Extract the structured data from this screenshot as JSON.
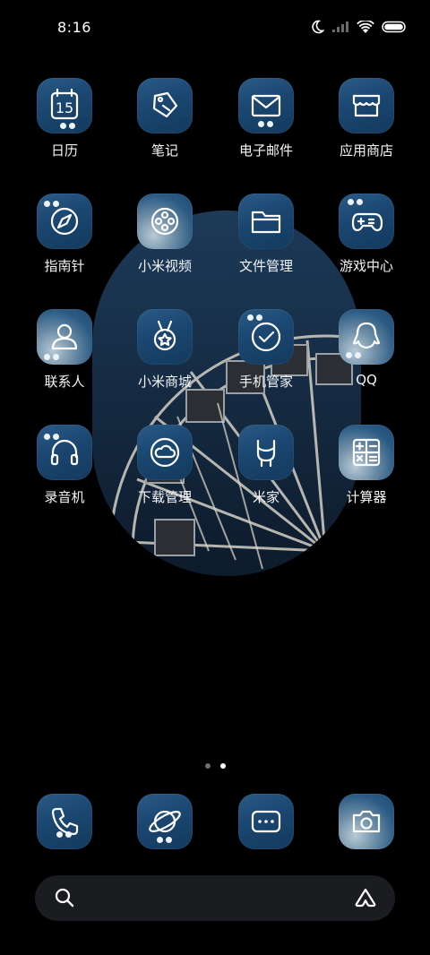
{
  "status_bar": {
    "time": "8:16",
    "icons": [
      "moon-icon",
      "signal-icon",
      "wifi-icon",
      "battery-icon"
    ]
  },
  "apps": [
    {
      "label": "日历",
      "icon": "calendar-icon",
      "badge": "15"
    },
    {
      "label": "笔记",
      "icon": "notes-icon"
    },
    {
      "label": "电子邮件",
      "icon": "mail-icon"
    },
    {
      "label": "应用商店",
      "icon": "store-icon"
    },
    {
      "label": "指南针",
      "icon": "compass-icon"
    },
    {
      "label": "小米视频",
      "icon": "video-icon"
    },
    {
      "label": "文件管理",
      "icon": "folder-icon"
    },
    {
      "label": "游戏中心",
      "icon": "gamepad-icon"
    },
    {
      "label": "联系人",
      "icon": "contact-icon"
    },
    {
      "label": "小米商城",
      "icon": "medal-icon"
    },
    {
      "label": "手机管家",
      "icon": "security-check-icon"
    },
    {
      "label": "QQ",
      "icon": "qq-icon"
    },
    {
      "label": "录音机",
      "icon": "headphones-icon"
    },
    {
      "label": "下载管理",
      "icon": "cloud-download-icon"
    },
    {
      "label": "米家",
      "icon": "mihome-icon"
    },
    {
      "label": "计算器",
      "icon": "calculator-icon"
    }
  ],
  "pager": {
    "pages": 2,
    "current": 2
  },
  "dock": [
    {
      "icon": "phone-icon"
    },
    {
      "icon": "browser-planet-icon"
    },
    {
      "icon": "messages-icon"
    },
    {
      "icon": "camera-icon"
    }
  ],
  "search_bar": {
    "icons": [
      "search-icon",
      "assistant-icon"
    ]
  }
}
